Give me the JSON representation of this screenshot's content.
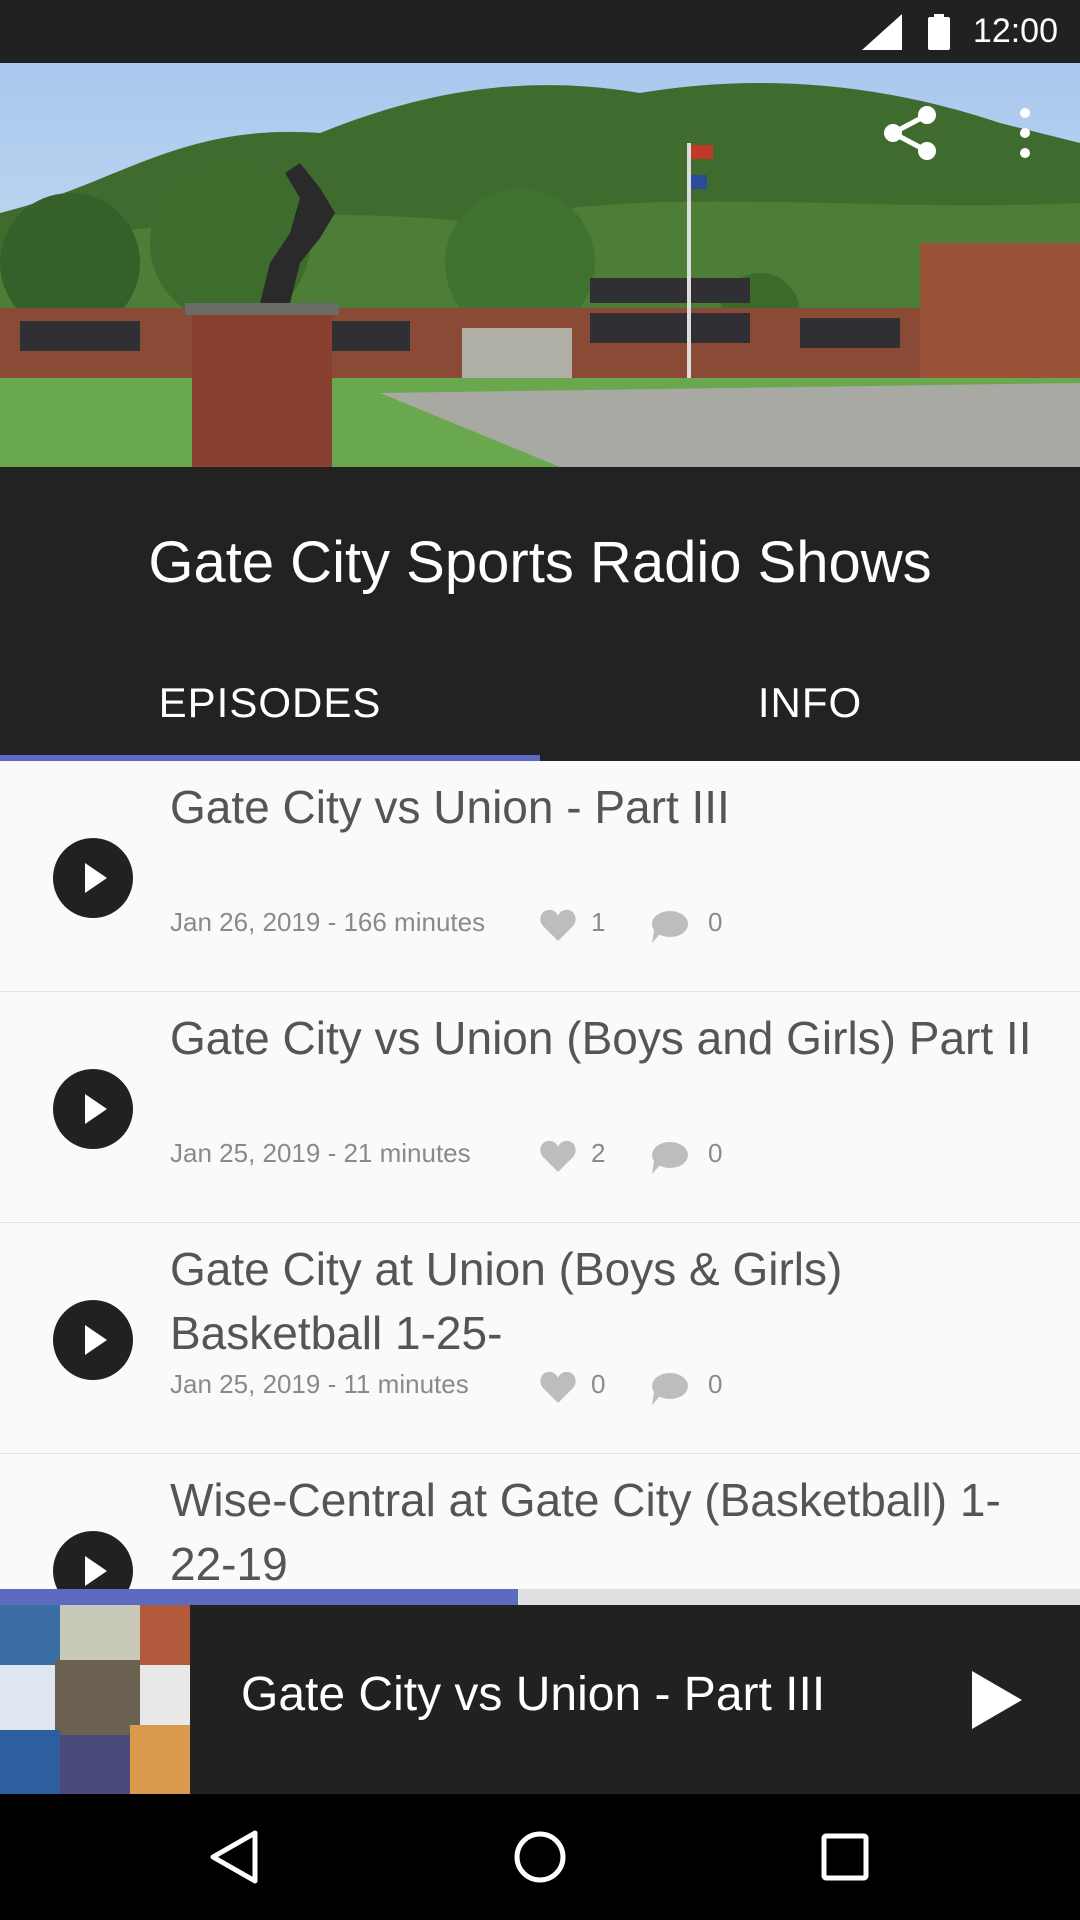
{
  "status_bar": {
    "time": "12:00"
  },
  "header": {
    "show_title": "Gate City Sports Radio Shows",
    "share_icon": "share-icon",
    "menu_icon": "more-vert-icon"
  },
  "tabs": [
    {
      "label": "EPISODES",
      "selected": true
    },
    {
      "label": "INFO",
      "selected": false
    }
  ],
  "episodes": [
    {
      "title": "Gate City vs Union - Part III",
      "meta": "Jan 26, 2019 - 166 minutes",
      "likes": "1",
      "comments": "0"
    },
    {
      "title": "Gate City vs Union (Boys and Girls) Part II",
      "meta": "Jan 25, 2019 - 21 minutes",
      "likes": "2",
      "comments": "0"
    },
    {
      "title": "Gate City at Union (Boys & Girls) Basketball 1-25-",
      "meta": "Jan 25, 2019 - 11 minutes",
      "likes": "0",
      "comments": "0"
    },
    {
      "title": "Wise-Central at Gate City (Basketball) 1-22-19",
      "meta": "",
      "likes": "",
      "comments": ""
    }
  ],
  "player": {
    "title": "Gate City vs Union - Part III",
    "progress": 0.48
  },
  "colors": {
    "accent": "#5c6bc0",
    "dark": "#222222"
  }
}
